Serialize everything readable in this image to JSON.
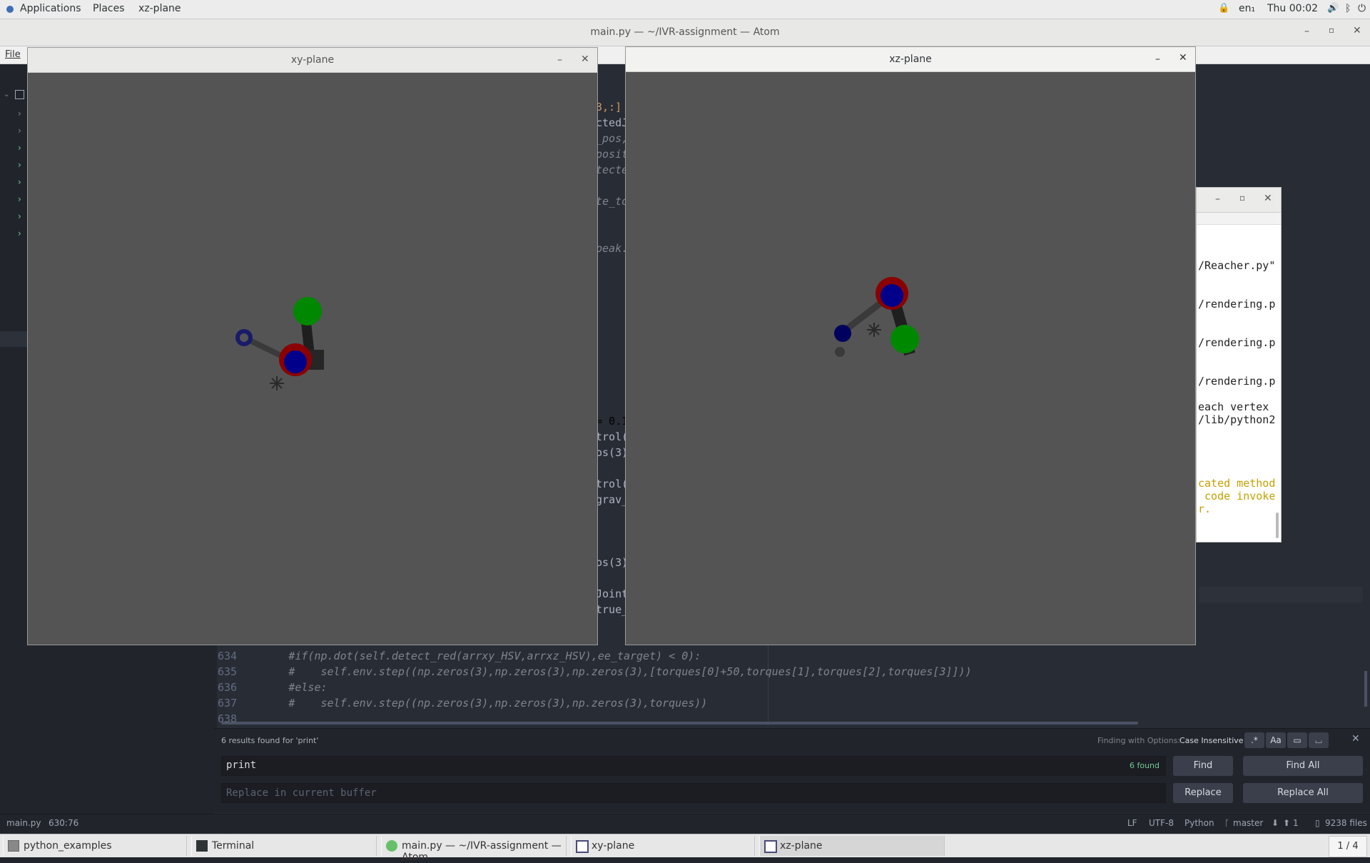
{
  "topbar": {
    "applications": "Applications",
    "places": "Places",
    "active_app": "xz-plane",
    "lang": "en₁",
    "clock": "Thu 00:02"
  },
  "atom": {
    "title": "main.py — ~/IVR-assignment — Atom",
    "menu_file": "File",
    "code_fragments": [
      {
        "text": "3,:]",
        "color": "#d19a66"
      },
      {
        "text": "ctedJ",
        "color": "#abb2bf"
      },
      {
        "text": "_pos,",
        "color": "#7f848e"
      },
      {
        "text": "posit",
        "color": "#7f848e"
      },
      {
        "text": "tecte",
        "color": "#7f848e"
      },
      {
        "text": "te_to",
        "color": "#7f848e"
      },
      {
        "text": "peak.",
        "color": "#7f848e"
      },
      {
        "text": "= 0.1",
        "color": "#d19a66"
      },
      {
        "text": "trol(",
        "color": "#abb2bf"
      },
      {
        "text": "os(3)",
        "color": "#abb2bf"
      },
      {
        "text": "trol(",
        "color": "#abb2bf"
      },
      {
        "text": "grav_",
        "color": "#abb2bf"
      },
      {
        "text": "os(3)",
        "color": "#abb2bf"
      },
      {
        "text": "Joint",
        "color": "#abb2bf"
      },
      {
        "text": "true_",
        "color": "#abb2bf"
      }
    ],
    "code_lines": [
      {
        "num": "634",
        "text": "        #if(np.dot(self.detect_red(arrxy_HSV,arrxz_HSV),ee_target) < 0):"
      },
      {
        "num": "635",
        "text": "        #    self.env.step((np.zeros(3),np.zeros(3),np.zeros(3),[torques[0]+50,torques[1],torques[2],torques[3]]))"
      },
      {
        "num": "636",
        "text": "        #else:"
      },
      {
        "num": "637",
        "text": "        #    self.env.step((np.zeros(3),np.zeros(3),np.zeros(3),torques))"
      },
      {
        "num": "638",
        "text": ""
      }
    ],
    "find": {
      "results": "6 results found for 'print'",
      "options_label": "Finding with Options:",
      "options_value": "Case Insensitive",
      "query": "print",
      "count": "6 found",
      "replace_placeholder": "Replace in current buffer",
      "find_btn": "Find",
      "find_all_btn": "Find All",
      "replace_btn": "Replace",
      "replace_all_btn": "Replace All",
      "opt_regex": ".*",
      "opt_case": "Aa"
    },
    "status": {
      "file": "main.py",
      "cursor": "630:76",
      "eol": "LF",
      "encoding": "UTF-8",
      "grammar": "Python",
      "branch": "master",
      "push": "1",
      "files": "9238 files"
    }
  },
  "xy_window": {
    "title": "xy-plane"
  },
  "xz_window": {
    "title": "xz-plane"
  },
  "terminal": {
    "lines": [
      {
        "text": "/Reacher.py\"",
        "warn": false
      },
      {
        "text": "/rendering.p",
        "warn": false
      },
      {
        "text": "/rendering.p",
        "warn": false
      },
      {
        "text": "/rendering.p",
        "warn": false
      },
      {
        "text": "each vertex",
        "warn": false
      },
      {
        "text": "/lib/python2",
        "warn": false
      },
      {
        "text": "cated method",
        "warn": true
      },
      {
        "text": " code invoke",
        "warn": true
      },
      {
        "text": "r.",
        "warn": true
      }
    ]
  },
  "taskbar": {
    "items": [
      "python_examples",
      "Terminal",
      "main.py — ~/IVR-assignment — Atom",
      "xy-plane",
      "xz-plane"
    ],
    "workspace": "1 / 4"
  },
  "colors": {
    "target_red": "#8b0000",
    "joint_blue": "#00008b",
    "joint_green": "#008800"
  }
}
